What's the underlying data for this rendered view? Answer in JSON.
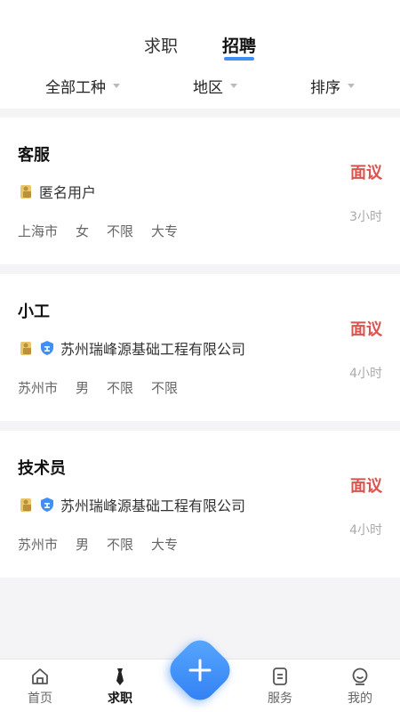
{
  "tabs": [
    {
      "label": "求职"
    },
    {
      "label": "招聘"
    }
  ],
  "active_tab": "招聘",
  "filters": [
    {
      "label": "全部工种"
    },
    {
      "label": "地区"
    },
    {
      "label": "排序"
    }
  ],
  "jobs": [
    {
      "title": "客服",
      "salary": "面议",
      "company": "匿名用户",
      "certified": false,
      "time": "3小时",
      "tags": [
        "上海市",
        "女",
        "不限",
        "大专"
      ]
    },
    {
      "title": "小工",
      "salary": "面议",
      "company": "苏州瑞峰源基础工程有限公司",
      "certified": true,
      "time": "4小时",
      "tags": [
        "苏州市",
        "男",
        "不限",
        "不限"
      ]
    },
    {
      "title": "技术员",
      "salary": "面议",
      "company": "苏州瑞峰源基础工程有限公司",
      "certified": true,
      "time": "4小时",
      "tags": [
        "苏州市",
        "男",
        "不限",
        "大专"
      ]
    }
  ],
  "bottom_nav": [
    {
      "label": "首页",
      "icon": "home-icon"
    },
    {
      "label": "求职",
      "icon": "tie-icon"
    },
    {
      "label": "服务",
      "icon": "document-icon"
    },
    {
      "label": "我的",
      "icon": "profile-icon"
    }
  ],
  "colors": {
    "accent": "#3f8ff5",
    "salary": "#d9534f",
    "fab": "#2f7ef2"
  }
}
